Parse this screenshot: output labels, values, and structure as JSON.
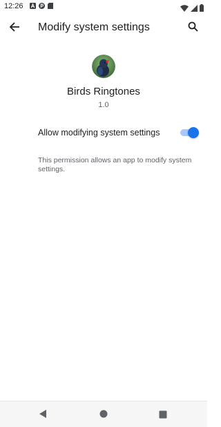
{
  "status_bar": {
    "time": "12:26",
    "notification_icons": [
      "a-icon",
      "p-icon",
      "sd-card-icon"
    ],
    "system_icons": [
      "wifi-icon",
      "signal-icon",
      "battery-icon"
    ]
  },
  "app_bar": {
    "title": "Modify system settings",
    "back_icon": "arrow-back-icon",
    "search_icon": "search-icon"
  },
  "app_info": {
    "name": "Birds Ringtones",
    "version": "1.0",
    "icon": "bird-app-icon"
  },
  "setting": {
    "label": "Allow modifying system settings",
    "enabled": true,
    "accent_color": "#1a73e8"
  },
  "description": "This permission allows an app to modify system settings.",
  "nav_bar": {
    "icons": [
      "triangle-back-icon",
      "circle-home-icon",
      "square-recents-icon"
    ]
  }
}
